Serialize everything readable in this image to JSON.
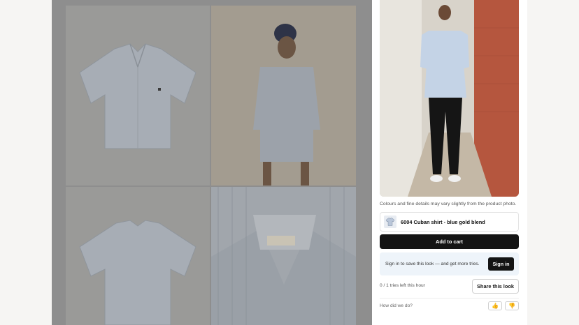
{
  "gallery": {
    "tiles": [
      "shirt-front",
      "model-front",
      "shirt-back",
      "collar-closeup"
    ]
  },
  "panel": {
    "tryon_photo": "model-wearing-shirt",
    "disclaimer": "Colours and fine details may vary slightly from the product photo.",
    "product": {
      "name": "6004 Cuban shirt - blue gold blend",
      "thumb_icon": "shirt-icon"
    },
    "add_to_cart_label": "Add to cart",
    "signin_prompt": "Sign in to save this look — and get more tries.",
    "signin_label": "Sign in",
    "tries_left": "0 / 1 tries left this hour",
    "share_label": "Share this look",
    "feedback_prompt": "How did we do?",
    "thumbs_up_icon": "thumbs-up-icon",
    "thumbs_down_icon": "thumbs-down-icon"
  },
  "colors": {
    "overlay": "#8e8e8e",
    "primary_button": "#141414",
    "signin_box": "#eef4fa"
  }
}
